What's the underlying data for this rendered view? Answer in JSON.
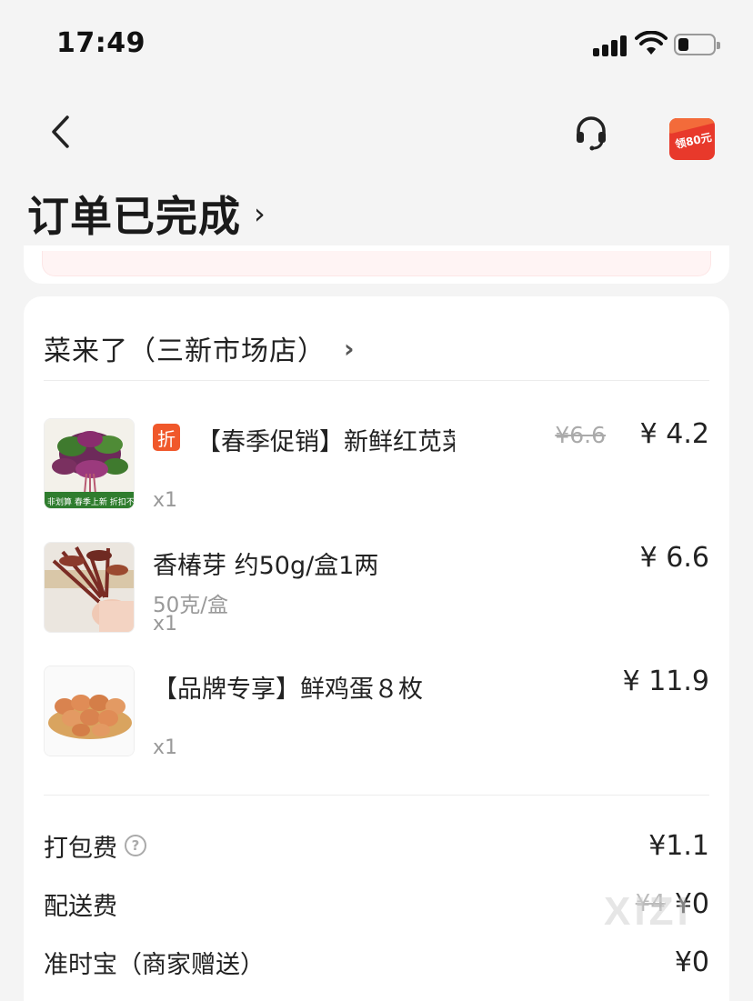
{
  "status_bar": {
    "time": "17:49",
    "battery_level": 0.3
  },
  "nav": {
    "coupon_text": "领80元"
  },
  "header": {
    "order_status": "订单已完成",
    "chevron": "›"
  },
  "store": {
    "name": "菜来了（三新市场店）",
    "chevron": "›"
  },
  "items": [
    {
      "name": "【春季促销】新鲜红苋菜（红…",
      "badge": "折",
      "original_price": "¥6.6",
      "price": "¥ 4.2",
      "spec": "",
      "qty": "x1",
      "thumb_caption": "非划算 春季上新 折扣不停",
      "image": "red-amaranth-thumbnail"
    },
    {
      "name": "香椿芽 约50g/盒1两",
      "badge": "",
      "original_price": "",
      "price": "¥ 6.6",
      "spec": "50克/盒",
      "qty": "x1",
      "image": "toon-sprouts-thumbnail"
    },
    {
      "name": "【品牌专享】鲜鸡蛋８枚",
      "badge": "",
      "original_price": "",
      "price": "¥ 11.9",
      "spec": "",
      "qty": "x1",
      "image": "eggs-thumbnail"
    }
  ],
  "fees": [
    {
      "label": "打包费",
      "value": "¥1.1",
      "original": "",
      "help": "?"
    },
    {
      "label": "配送费",
      "value": "¥0",
      "original": "¥4",
      "help": ""
    },
    {
      "label": "准时宝（商家赠送）",
      "value": "¥0",
      "original": "",
      "help": ""
    }
  ],
  "watermark": "XIZI",
  "colors": {
    "accent": "#f0582b",
    "badge": "#f0582b",
    "coupon": "#e8392b",
    "background": "#f4f4f4"
  }
}
